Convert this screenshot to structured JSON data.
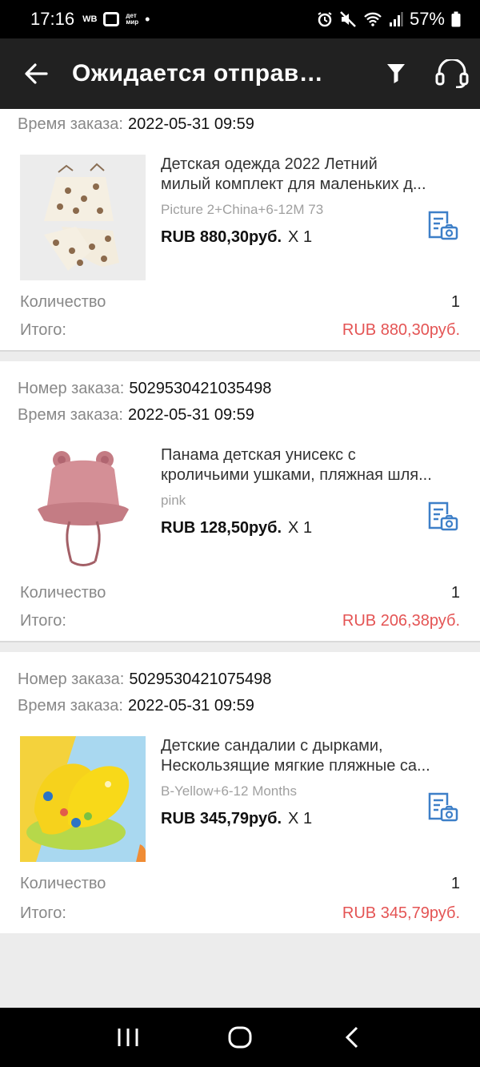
{
  "status": {
    "time": "17:16",
    "wb": "WB",
    "detmir_top": "дет",
    "detmir_bottom": "мир",
    "dot": "•",
    "battery": "57%"
  },
  "appbar": {
    "title": "Ожидается отправ…"
  },
  "labels": {
    "order_number": "Номер заказа:",
    "order_time": "Время заказа:",
    "quantity": "Количество",
    "total": "Итого:"
  },
  "orders": [
    {
      "time": "2022-05-31 09:59",
      "name_line1": "Детская одежда 2022 Летний",
      "name_line2": "милый комплект для маленьких д...",
      "variant": "Picture 2+China+6-12M 73",
      "price": "RUB 880,30руб.",
      "qty_suffix": "X 1",
      "quantity": "1",
      "total": "RUB 880,30руб."
    },
    {
      "number": "5029530421035498",
      "time": "2022-05-31 09:59",
      "name_line1": "Панама детская унисекс с",
      "name_line2": "кроличьими ушками, пляжная шля...",
      "variant": "pink",
      "price": "RUB 128,50руб.",
      "qty_suffix": "X 1",
      "quantity": "1",
      "total": "RUB 206,38руб."
    },
    {
      "number": "5029530421075498",
      "time": "2022-05-31 09:59",
      "name_line1": "Детские сандалии с дырками,",
      "name_line2": "Нескользящие мягкие пляжные са...",
      "variant": "B-Yellow+6-12 Months",
      "price": "RUB 345,79руб.",
      "qty_suffix": "X 1",
      "quantity": "1",
      "total": "RUB 345,79руб."
    }
  ],
  "colors": {
    "accent_red": "#e45454",
    "icon_blue": "#3d7fc8",
    "appbar": "#212121"
  },
  "icons": [
    "back-arrow-icon",
    "filter-icon",
    "support-headset-icon",
    "receipt-photo-icon",
    "recent-apps-icon",
    "home-icon",
    "nav-back-icon"
  ]
}
